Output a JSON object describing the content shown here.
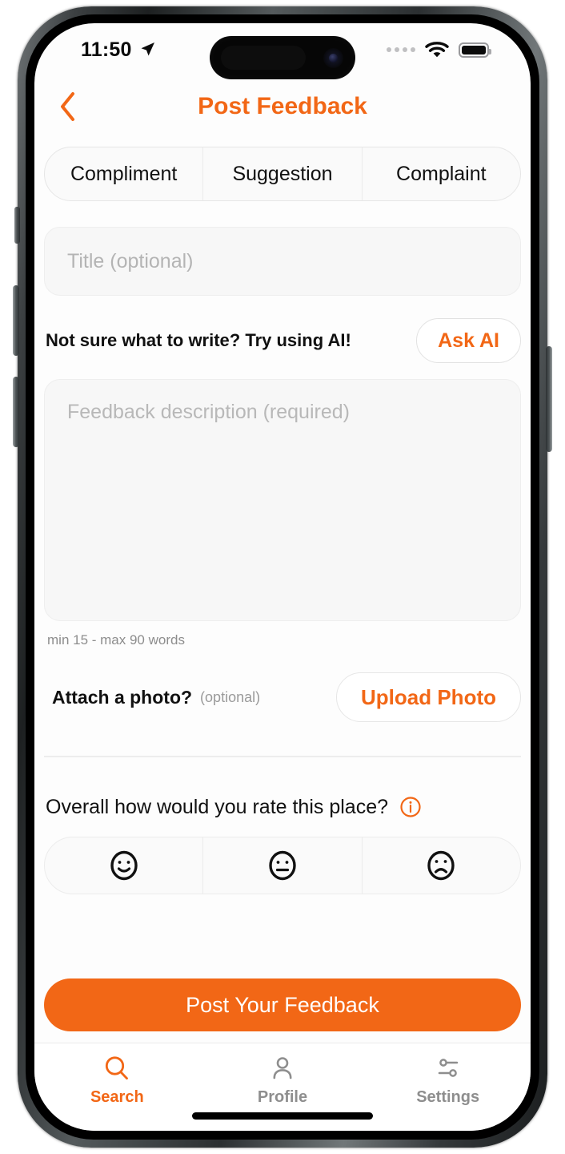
{
  "status_bar": {
    "time": "11:50",
    "location_icon": "location-arrow-icon",
    "cellular_icon": "cellular-dots-icon",
    "wifi_icon": "wifi-icon",
    "battery_icon": "battery-full-icon"
  },
  "header": {
    "back_icon": "chevron-left-icon",
    "title": "Post Feedback"
  },
  "colors": {
    "accent": "#F26716",
    "text_primary": "#111111",
    "text_muted": "#8d8d8d",
    "field_bg": "#f7f7f7",
    "border": "#ececec"
  },
  "segmented_control": {
    "options": [
      {
        "label": "Compliment",
        "selected": false
      },
      {
        "label": "Suggestion",
        "selected": false
      },
      {
        "label": "Complaint",
        "selected": false
      }
    ]
  },
  "title_field": {
    "value": "",
    "placeholder": "Title (optional)"
  },
  "ai_prompt": {
    "text": "Not sure what to write? Try using AI!",
    "button_label": "Ask AI"
  },
  "description_field": {
    "value": "",
    "placeholder": "Feedback description (required)",
    "helper": "min 15 - max 90 words"
  },
  "photo_section": {
    "label": "Attach a photo?",
    "optional_note": "(optional)",
    "button_label": "Upload Photo"
  },
  "rating_section": {
    "question": "Overall how would you rate this place?",
    "info_icon": "info-circle-icon",
    "options": [
      {
        "name": "happy-face-icon",
        "value": "positive"
      },
      {
        "name": "neutral-face-icon",
        "value": "neutral"
      },
      {
        "name": "sad-face-icon",
        "value": "negative"
      }
    ]
  },
  "submit": {
    "label": "Post Your Feedback"
  },
  "tab_bar": {
    "items": [
      {
        "label": "Search",
        "icon": "search-icon",
        "active": true
      },
      {
        "label": "Profile",
        "icon": "person-icon",
        "active": false
      },
      {
        "label": "Settings",
        "icon": "sliders-icon",
        "active": false
      }
    ]
  }
}
